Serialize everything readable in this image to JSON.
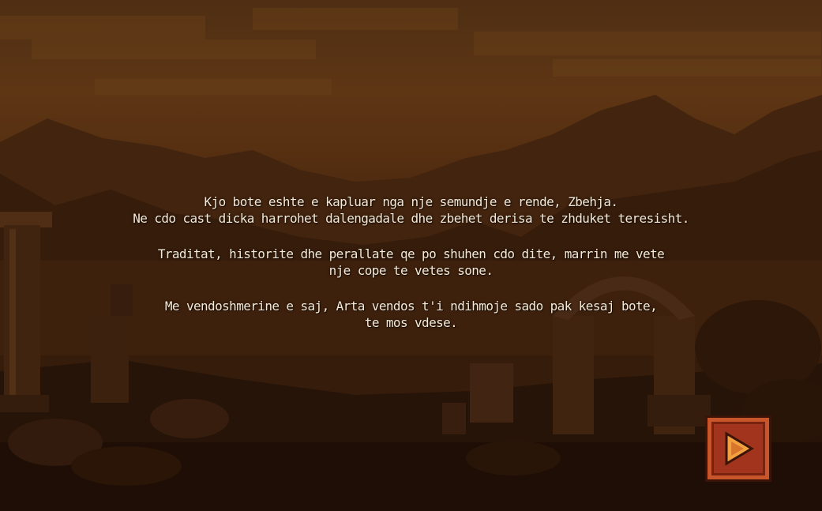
{
  "story": {
    "paragraphs": [
      {
        "lines": [
          "Kjo bote eshte e kapluar nga nje semundje e rende, Zbehja.",
          "Ne cdo cast dicka harrohet dalengadale dhe zbehet derisa te zhduket teresisht."
        ]
      },
      {
        "lines": [
          "Traditat, historite dhe perallate qe po shuhen cdo dite, marrin me vete",
          "nje cope te vetes sone."
        ]
      },
      {
        "lines": [
          "Me vendoshmerine e saj, Arta vendos t'i ndihmoje sado pak kesaj bote,",
          "te mos vdese."
        ]
      }
    ]
  },
  "controls": {
    "next_icon": "play-arrow-icon"
  },
  "colors": {
    "text": "#f3ead8",
    "button_fill": "#a2331d",
    "button_border": "#3a1407",
    "sky": "#6b3e17"
  }
}
